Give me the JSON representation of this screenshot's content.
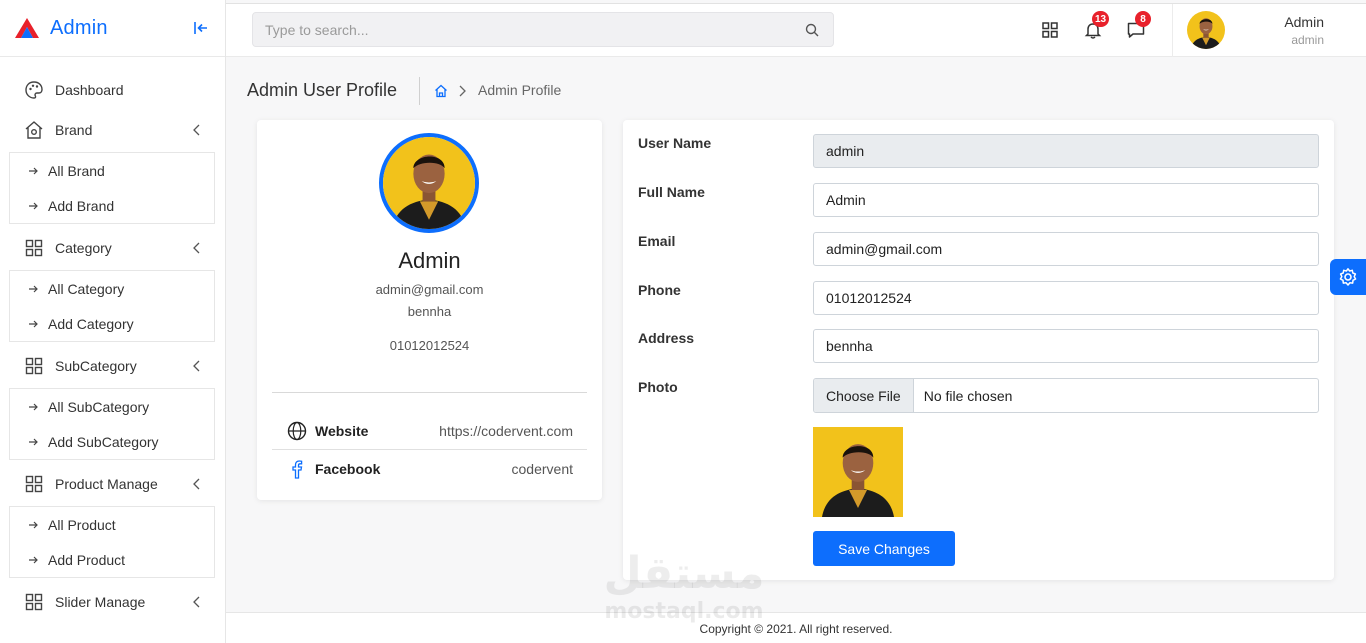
{
  "app": {
    "title": "Admin"
  },
  "search": {
    "placeholder": "Type to search..."
  },
  "topbar": {
    "notifications_count": "13",
    "messages_count": "8",
    "user_name": "Admin",
    "user_role": "admin"
  },
  "sidebar": {
    "dashboard": "Dashboard",
    "groups": [
      {
        "label": "Brand",
        "items": [
          "All Brand",
          "Add Brand"
        ]
      },
      {
        "label": "Category",
        "items": [
          "All Category",
          "Add Category"
        ]
      },
      {
        "label": "SubCategory",
        "items": [
          "All SubCategory",
          "Add SubCategory"
        ]
      },
      {
        "label": "Product Manage",
        "items": [
          "All Product",
          "Add Product"
        ]
      },
      {
        "label": "Slider Manage",
        "items": []
      }
    ]
  },
  "page": {
    "title": "Admin User Profile",
    "breadcrumb": "Admin Profile"
  },
  "profile": {
    "name": "Admin",
    "email": "admin@gmail.com",
    "address": "bennha",
    "phone": "01012012524",
    "links": [
      {
        "label": "Website",
        "value": "https://codervent.com",
        "icon": "globe-icon"
      },
      {
        "label": "Facebook",
        "value": "codervent",
        "icon": "facebook-icon"
      }
    ]
  },
  "form": {
    "labels": {
      "username": "User Name",
      "fullname": "Full Name",
      "email": "Email",
      "phone": "Phone",
      "address": "Address",
      "photo": "Photo"
    },
    "values": {
      "username": "admin",
      "fullname": "Admin",
      "email": "admin@gmail.com",
      "phone": "01012012524",
      "address": "bennha"
    },
    "file_button": "Choose File",
    "file_status": "No file chosen",
    "save_label": "Save Changes"
  },
  "footer": {
    "text": "Copyright © 2021. All right reserved."
  },
  "watermark": {
    "arabic": "مستقل",
    "latin": "mostaql.com"
  },
  "colors": {
    "primary": "#0d6efd",
    "badge": "#e8212b",
    "avatar_bg": "#f5c518"
  }
}
